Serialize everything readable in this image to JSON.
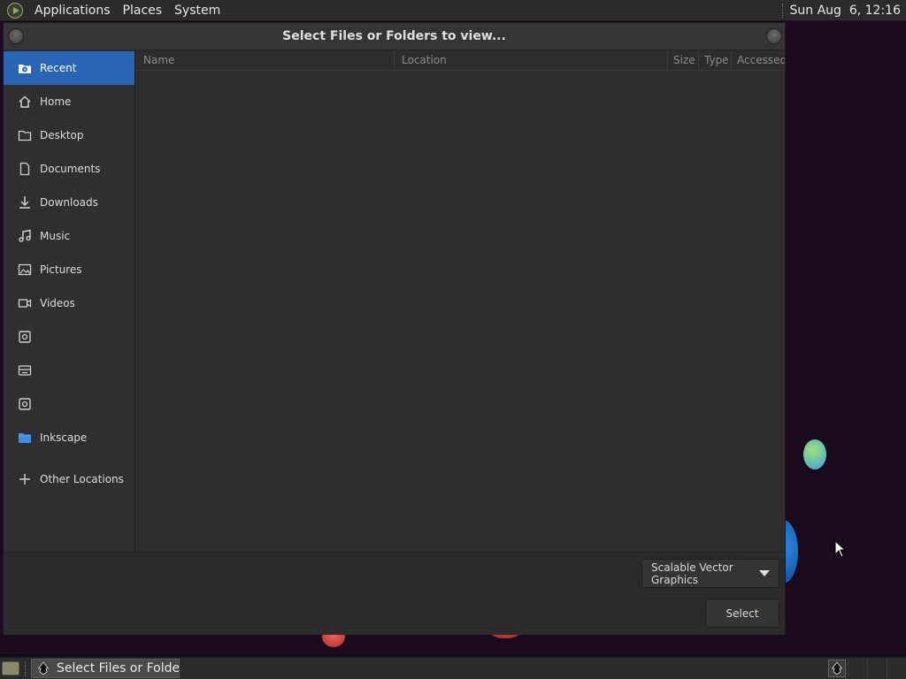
{
  "top_panel": {
    "menus": [
      "Applications",
      "Places",
      "System"
    ],
    "clock": "Sun Aug  6, 12:16"
  },
  "dialog": {
    "title": "Select Files or Folders to view...",
    "sidebar": [
      {
        "label": "Recent",
        "icon": "clock-folder-icon",
        "active": true
      },
      {
        "label": "Home",
        "icon": "home-icon"
      },
      {
        "label": "Desktop",
        "icon": "folder-icon"
      },
      {
        "label": "Documents",
        "icon": "document-icon"
      },
      {
        "label": "Downloads",
        "icon": "download-icon"
      },
      {
        "label": "Music",
        "icon": "music-icon"
      },
      {
        "label": "Pictures",
        "icon": "picture-icon"
      },
      {
        "label": "Videos",
        "icon": "video-icon"
      },
      {
        "label": "",
        "icon": "drive-icon"
      },
      {
        "label": "",
        "icon": "optical-disc-icon"
      },
      {
        "label": "",
        "icon": "drive-icon"
      },
      {
        "label": "Inkscape",
        "icon": "folder-icon"
      }
    ],
    "other_locations": "Other Locations",
    "columns": [
      "Name",
      "Location",
      "Size",
      "Type",
      "Accessed"
    ],
    "filter": "Scalable Vector Graphics",
    "select_button": "Select"
  },
  "taskbar": {
    "task_label": "Select Files or Folde..."
  }
}
